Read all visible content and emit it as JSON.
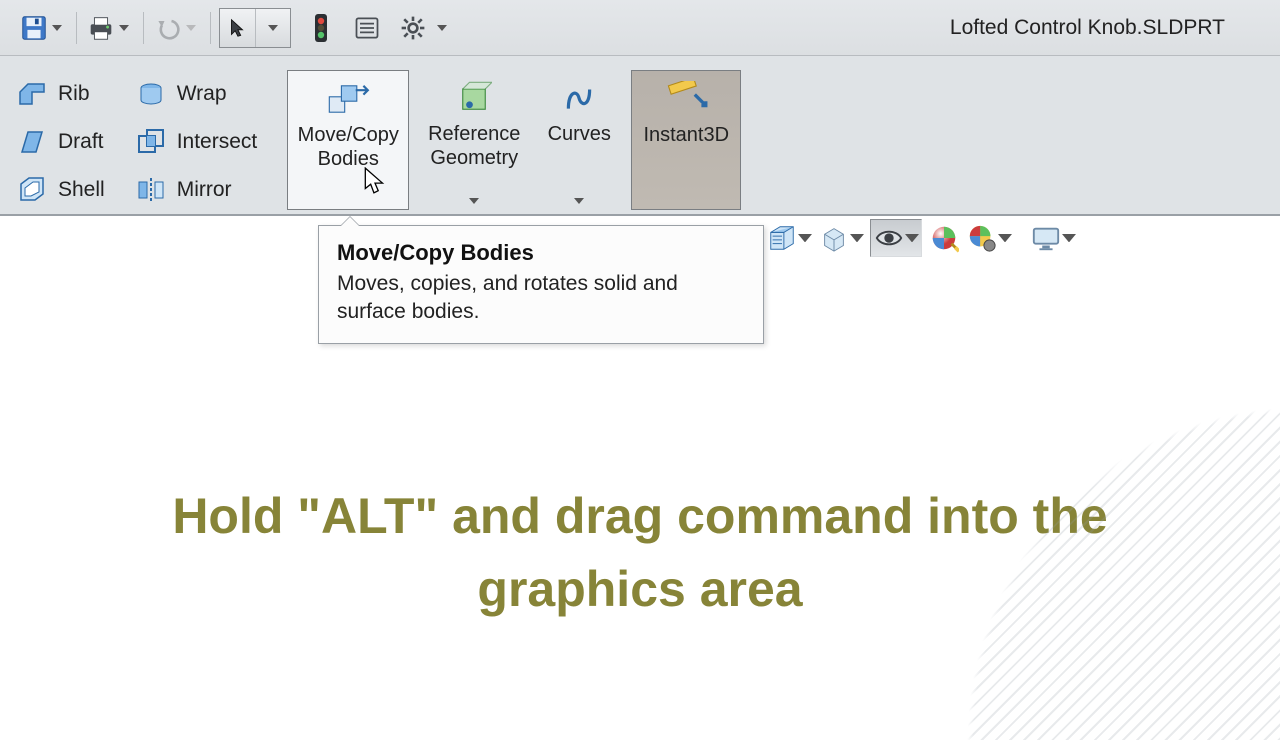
{
  "document_title": "Lofted Control Knob.SLDPRT",
  "quick_access": {
    "save": "save-icon",
    "print": "print-icon",
    "undo": "undo-icon"
  },
  "ribbon": {
    "small": {
      "rib": "Rib",
      "wrap": "Wrap",
      "draft": "Draft",
      "intersect": "Intersect",
      "shell": "Shell",
      "mirror": "Mirror"
    },
    "move_copy_label": "Move/Copy\nBodies",
    "ref_geo_label": "Reference\nGeometry",
    "curves_label": "Curves",
    "instant3d_label": "Instant3D"
  },
  "tooltip": {
    "title": "Move/Copy Bodies",
    "desc": "Moves, copies, and rotates solid and surface bodies."
  },
  "instruction": "Hold \"ALT\" and drag command into the graphics area"
}
